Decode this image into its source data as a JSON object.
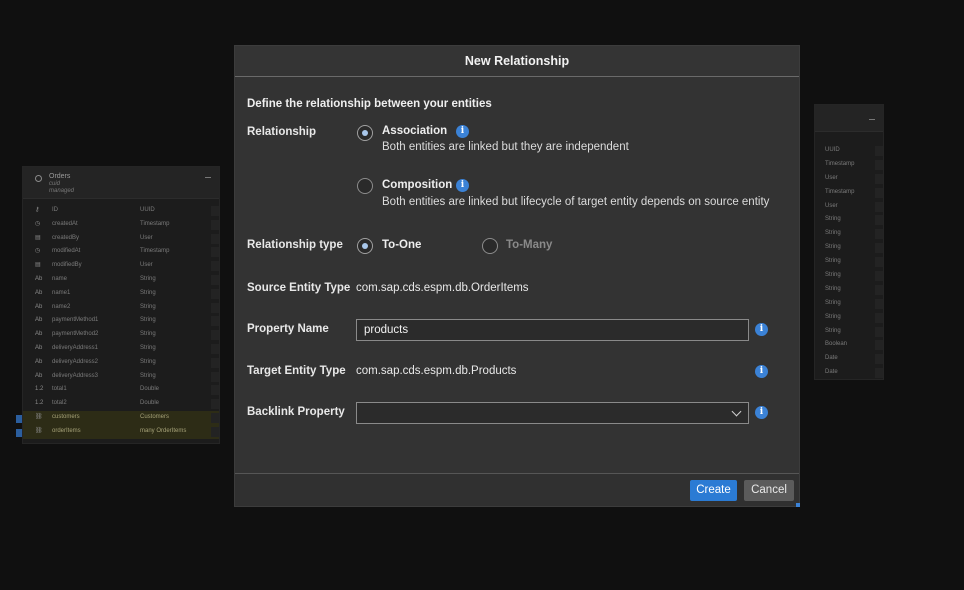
{
  "dialog": {
    "title": "New Relationship",
    "intro": "Define the relationship between your entities",
    "relationship": {
      "label": "Relationship",
      "options": [
        {
          "label": "Association",
          "description": "Both entities are linked but they are independent",
          "selected": true
        },
        {
          "label": "Composition",
          "description": "Both entities are linked but lifecycle of target entity depends on source entity",
          "selected": false
        }
      ]
    },
    "relationship_type": {
      "label": "Relationship type",
      "options": [
        {
          "label": "To-One",
          "selected": true
        },
        {
          "label": "To-Many",
          "selected": false
        }
      ]
    },
    "source_entity": {
      "label": "Source Entity Type",
      "value": "com.sap.cds.espm.db.OrderItems"
    },
    "property_name": {
      "label": "Property Name",
      "value": "products"
    },
    "target_entity": {
      "label": "Target Entity Type",
      "value": "com.sap.cds.espm.db.Products"
    },
    "backlink": {
      "label": "Backlink Property",
      "value": ""
    },
    "buttons": {
      "create": "Create",
      "cancel": "Cancel"
    },
    "info_glyph": "i"
  },
  "background_entity": {
    "name": "Orders",
    "sub1": "cuid",
    "sub2": "managed",
    "fields": [
      {
        "icon": "key-icon",
        "glyph": "⚷",
        "name": "ID",
        "type": "UUID"
      },
      {
        "icon": "clock-icon",
        "glyph": "◷",
        "name": "createdAt",
        "type": "Timestamp"
      },
      {
        "icon": "calendar-icon",
        "glyph": "▤",
        "name": "createdBy",
        "type": "User"
      },
      {
        "icon": "clock-icon",
        "glyph": "◷",
        "name": "modifiedAt",
        "type": "Timestamp"
      },
      {
        "icon": "calendar-icon",
        "glyph": "▤",
        "name": "modifiedBy",
        "type": "User"
      },
      {
        "icon": "string-icon",
        "glyph": "Ab",
        "name": "name",
        "type": "String"
      },
      {
        "icon": "string-icon",
        "glyph": "Ab",
        "name": "name1",
        "type": "String"
      },
      {
        "icon": "string-icon",
        "glyph": "Ab",
        "name": "name2",
        "type": "String"
      },
      {
        "icon": "string-icon",
        "glyph": "Ab",
        "name": "paymentMethod1",
        "type": "String"
      },
      {
        "icon": "string-icon",
        "glyph": "Ab",
        "name": "paymentMethod2",
        "type": "String"
      },
      {
        "icon": "string-icon",
        "glyph": "Ab",
        "name": "deliveryAddress1",
        "type": "String"
      },
      {
        "icon": "string-icon",
        "glyph": "Ab",
        "name": "deliveryAddress2",
        "type": "String"
      },
      {
        "icon": "string-icon",
        "glyph": "Ab",
        "name": "deliveryAddress3",
        "type": "String"
      },
      {
        "icon": "number-icon",
        "glyph": "1.2",
        "name": "total1",
        "type": "Double"
      },
      {
        "icon": "number-icon",
        "glyph": "1.2",
        "name": "total2",
        "type": "Double"
      },
      {
        "icon": "link-icon",
        "glyph": "⛓",
        "name": "customers",
        "type": "Customers"
      },
      {
        "icon": "link-icon",
        "glyph": "⛓",
        "name": "orderItems",
        "type": "many OrderItems"
      }
    ]
  },
  "right_entity_types": [
    "UUID",
    "Timestamp",
    "User",
    "Timestamp",
    "User",
    "String",
    "String",
    "String",
    "String",
    "String",
    "String",
    "String",
    "String",
    "String",
    "Boolean",
    "Date",
    "Date"
  ],
  "colors": {
    "accent": "#2b7bd4",
    "info": "#3b82d6",
    "dialog_bg": "#333333",
    "backdrop": "#101010"
  }
}
